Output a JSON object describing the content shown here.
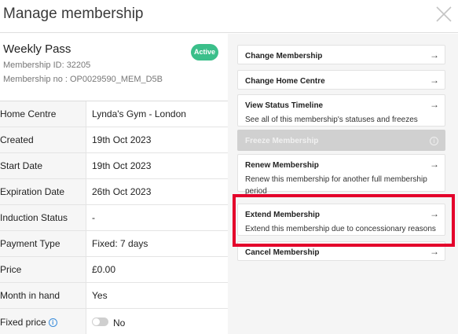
{
  "modal": {
    "title": "Manage membership"
  },
  "membership": {
    "name": "Weekly Pass",
    "id_text": "Membership ID: 32205",
    "no_text": "Membership no : OP0029590_MEM_D5B",
    "status": "Active",
    "status_color": "#3bbf8a"
  },
  "details": [
    {
      "label": "Home Centre",
      "value": "Lynda's Gym - London"
    },
    {
      "label": "Created",
      "value": "19th Oct 2023"
    },
    {
      "label": "Start Date",
      "value": "19th Oct 2023"
    },
    {
      "label": "Expiration Date",
      "value": "26th Oct 2023"
    },
    {
      "label": "Induction Status",
      "value": "-"
    },
    {
      "label": "Payment Type",
      "value": "Fixed: 7 days"
    },
    {
      "label": "Price",
      "value": "£0.00"
    },
    {
      "label": "Month in hand",
      "value": "Yes"
    },
    {
      "label": "Fixed price",
      "value": "No",
      "icon": "info-icon"
    }
  ],
  "actions": [
    {
      "label": "Change Membership",
      "description": "",
      "icon": "arrow-right-icon"
    },
    {
      "label": "Change Home Centre",
      "description": "",
      "icon": "arrow-right-icon"
    },
    {
      "label": "View Status Timeline",
      "description": "See all of this membership's statuses and freezes",
      "icon": "arrow-right-icon"
    },
    {
      "label": "Freeze Membership",
      "description": "",
      "icon": "info-icon",
      "disabled": true
    },
    {
      "label": "Renew Membership",
      "description": "Renew this membership for another full membership period",
      "icon": "arrow-right-icon"
    },
    {
      "label": "Extend Membership",
      "description": "Extend this membership due to concessionary reasons",
      "icon": "arrow-right-icon"
    },
    {
      "label": "Cancel Membership",
      "description": "",
      "icon": "arrow-right-icon"
    }
  ],
  "highlight_color": "#e4002b"
}
